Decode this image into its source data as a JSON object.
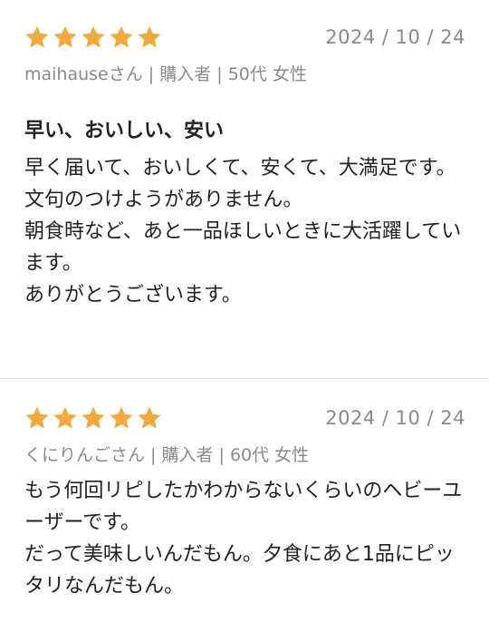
{
  "colors": {
    "star": "#F3A93B",
    "muted_text": "#8a8a8a",
    "text": "#222222",
    "divider": "#e3e3e3"
  },
  "reviews": [
    {
      "rating": 5,
      "date": "2024 / 10 / 24",
      "reviewer": "maihauseさん | 購入者 | 50代 女性",
      "title": "早い、おいしい、安い",
      "lines": [
        "早く届いて、おいしくて、安くて、大満足です。",
        "文句のつけようがありません。",
        "朝食時など、あと一品ほしいときに大活躍しています。",
        "ありがとうございます。"
      ]
    },
    {
      "rating": 5,
      "date": "2024 / 10 / 24",
      "reviewer": "くにりんごさん | 購入者 | 60代 女性",
      "lines": [
        "もう何回リピしたかわからないくらいのヘビーユーザーです。",
        "だって美味しいんだもん。夕食にあと1品にピッタリなんだもん。"
      ]
    }
  ]
}
